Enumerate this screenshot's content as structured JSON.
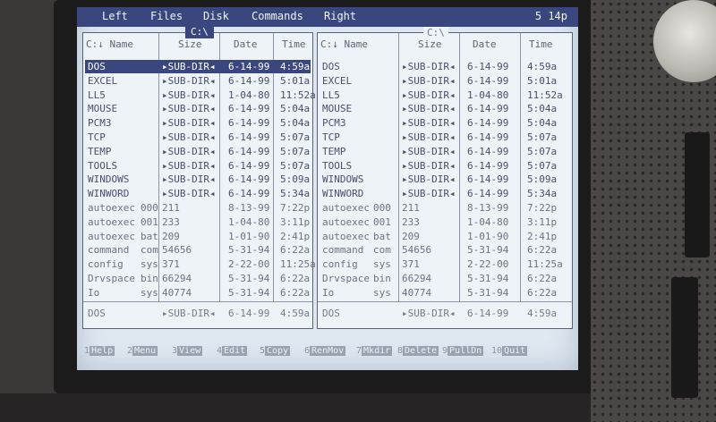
{
  "menu": {
    "items": [
      "Left",
      "Files",
      "Disk",
      "Commands",
      "Right"
    ],
    "clock": "5 14p"
  },
  "left_panel": {
    "title": "C:\\",
    "headers": {
      "name": "C:↓ Name",
      "size": "Size",
      "date": "Date",
      "time": "Time"
    },
    "rows": [
      {
        "name": "DOS",
        "ext": "",
        "size": "▸SUB-DIR◂",
        "date": "6-14-99",
        "time": "4:59a",
        "selected": true,
        "dir": true
      },
      {
        "name": "EXCEL",
        "ext": "",
        "size": "▸SUB-DIR◂",
        "date": "6-14-99",
        "time": "5:01a",
        "dir": true
      },
      {
        "name": "LL5",
        "ext": "",
        "size": "▸SUB-DIR◂",
        "date": "1-04-80",
        "time": "11:52a",
        "dir": true
      },
      {
        "name": "MOUSE",
        "ext": "",
        "size": "▸SUB-DIR◂",
        "date": "6-14-99",
        "time": "5:04a",
        "dir": true
      },
      {
        "name": "PCM3",
        "ext": "",
        "size": "▸SUB-DIR◂",
        "date": "6-14-99",
        "time": "5:04a",
        "dir": true
      },
      {
        "name": "TCP",
        "ext": "",
        "size": "▸SUB-DIR◂",
        "date": "6-14-99",
        "time": "5:07a",
        "dir": true
      },
      {
        "name": "TEMP",
        "ext": "",
        "size": "▸SUB-DIR◂",
        "date": "6-14-99",
        "time": "5:07a",
        "dir": true
      },
      {
        "name": "TOOLS",
        "ext": "",
        "size": "▸SUB-DIR◂",
        "date": "6-14-99",
        "time": "5:07a",
        "dir": true
      },
      {
        "name": "WINDOWS",
        "ext": "",
        "size": "▸SUB-DIR◂",
        "date": "6-14-99",
        "time": "5:09a",
        "dir": true
      },
      {
        "name": "WINWORD",
        "ext": "",
        "size": "▸SUB-DIR◂",
        "date": "6-14-99",
        "time": "5:34a",
        "dir": true
      },
      {
        "name": "autoexec",
        "ext": "000",
        "size": "211",
        "date": "8-13-99",
        "time": "7:22p"
      },
      {
        "name": "autoexec",
        "ext": "001",
        "size": "233",
        "date": "1-04-80",
        "time": "3:11p"
      },
      {
        "name": "autoexec",
        "ext": "bat",
        "size": "209",
        "date": "1-01-90",
        "time": "2:41p"
      },
      {
        "name": "command",
        "ext": "com",
        "size": "54656",
        "date": "5-31-94",
        "time": "6:22a"
      },
      {
        "name": "config",
        "ext": "sys",
        "size": "371",
        "date": "2-22-00",
        "time": "11:25a"
      },
      {
        "name": "Drvspace",
        "ext": "bin",
        "size": "66294",
        "date": "5-31-94",
        "time": "6:22a"
      },
      {
        "name": "Io",
        "ext": "sys",
        "size": "40774",
        "date": "5-31-94",
        "time": "6:22a"
      }
    ],
    "status": {
      "name": "DOS",
      "size": "▸SUB-DIR◂",
      "date": "6-14-99",
      "time": "4:59a"
    }
  },
  "right_panel": {
    "title": "C:\\",
    "headers": {
      "name": "C:↓ Name",
      "size": "Size",
      "date": "Date",
      "time": "Time"
    },
    "rows": [
      {
        "name": "DOS",
        "ext": "",
        "size": "▸SUB-DIR◂",
        "date": "6-14-99",
        "time": "4:59a",
        "dir": true
      },
      {
        "name": "EXCEL",
        "ext": "",
        "size": "▸SUB-DIR◂",
        "date": "6-14-99",
        "time": "5:01a",
        "dir": true
      },
      {
        "name": "LL5",
        "ext": "",
        "size": "▸SUB-DIR◂",
        "date": "1-04-80",
        "time": "11:52a",
        "dir": true
      },
      {
        "name": "MOUSE",
        "ext": "",
        "size": "▸SUB-DIR◂",
        "date": "6-14-99",
        "time": "5:04a",
        "dir": true
      },
      {
        "name": "PCM3",
        "ext": "",
        "size": "▸SUB-DIR◂",
        "date": "6-14-99",
        "time": "5:04a",
        "dir": true
      },
      {
        "name": "TCP",
        "ext": "",
        "size": "▸SUB-DIR◂",
        "date": "6-14-99",
        "time": "5:07a",
        "dir": true
      },
      {
        "name": "TEMP",
        "ext": "",
        "size": "▸SUB-DIR◂",
        "date": "6-14-99",
        "time": "5:07a",
        "dir": true
      },
      {
        "name": "TOOLS",
        "ext": "",
        "size": "▸SUB-DIR◂",
        "date": "6-14-99",
        "time": "5:07a",
        "dir": true
      },
      {
        "name": "WINDOWS",
        "ext": "",
        "size": "▸SUB-DIR◂",
        "date": "6-14-99",
        "time": "5:09a",
        "dir": true
      },
      {
        "name": "WINWORD",
        "ext": "",
        "size": "▸SUB-DIR◂",
        "date": "6-14-99",
        "time": "5:34a",
        "dir": true
      },
      {
        "name": "autoexec",
        "ext": "000",
        "size": "211",
        "date": "8-13-99",
        "time": "7:22p"
      },
      {
        "name": "autoexec",
        "ext": "001",
        "size": "233",
        "date": "1-04-80",
        "time": "3:11p"
      },
      {
        "name": "autoexec",
        "ext": "bat",
        "size": "209",
        "date": "1-01-90",
        "time": "2:41p"
      },
      {
        "name": "command",
        "ext": "com",
        "size": "54656",
        "date": "5-31-94",
        "time": "6:22a"
      },
      {
        "name": "config",
        "ext": "sys",
        "size": "371",
        "date": "2-22-00",
        "time": "11:25a"
      },
      {
        "name": "Drvspace",
        "ext": "bin",
        "size": "66294",
        "date": "5-31-94",
        "time": "6:22a"
      },
      {
        "name": "Io",
        "ext": "sys",
        "size": "40774",
        "date": "5-31-94",
        "time": "6:22a"
      }
    ],
    "status": {
      "name": "DOS",
      "size": "▸SUB-DIR◂",
      "date": "6-14-99",
      "time": "4:59a"
    }
  },
  "fkeys": [
    {
      "num": "1",
      "label": "Help"
    },
    {
      "num": "2",
      "label": "Menu"
    },
    {
      "num": "3",
      "label": "View"
    },
    {
      "num": "4",
      "label": "Edit"
    },
    {
      "num": "5",
      "label": "Copy"
    },
    {
      "num": "6",
      "label": "RenMov"
    },
    {
      "num": "7",
      "label": "Mkdir"
    },
    {
      "num": "8",
      "label": "Delete"
    },
    {
      "num": "9",
      "label": "PullDn"
    },
    {
      "num": "10",
      "label": "Quit"
    }
  ]
}
